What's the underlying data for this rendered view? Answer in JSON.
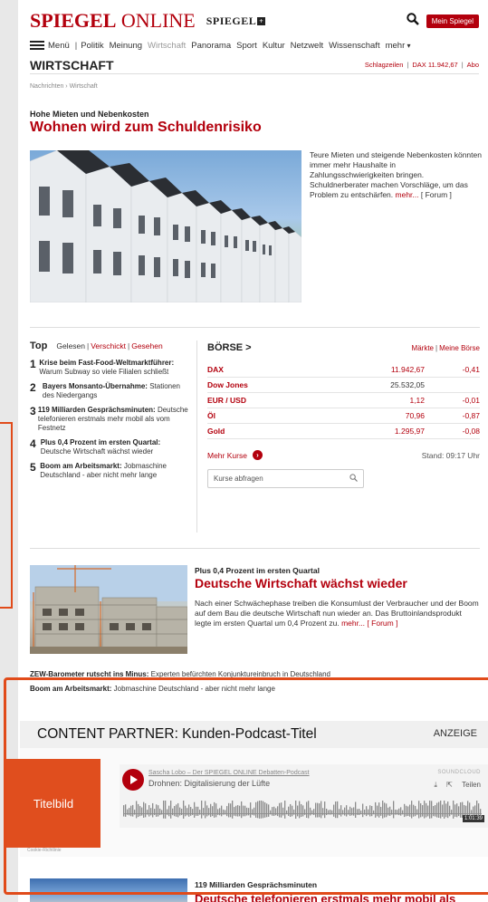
{
  "header": {
    "logo_main": "SPIEGEL",
    "logo_suffix": " ONLINE",
    "logo_secondary": "SPIEGEL",
    "logo_secondary_plus": "+",
    "search_icon": "search-icon",
    "mein_spiegel": "Mein Spiegel"
  },
  "nav": {
    "menu": "Menü",
    "items": [
      "Politik",
      "Meinung",
      "Wirtschaft",
      "Panorama",
      "Sport",
      "Kultur",
      "Netzwelt",
      "Wissenschaft"
    ],
    "more": "mehr"
  },
  "section": {
    "title": "WIRTSCHAFT",
    "link_schlagzeilen": "Schlagzeilen",
    "link_dax": "DAX 11.942,67",
    "link_abo": "Abo"
  },
  "breadcrumb": "Nachrichten › Wirtschaft",
  "lead": {
    "kicker": "Hohe Mieten und Nebenkosten",
    "headline": "Wohnen wird zum Schuldenrisiko",
    "teaser": "Teure Mieten und steigende Nebenkosten könnten immer mehr Haushalte in Zahlungsschwierigkeiten bringen. Schuldnerberater machen Vorschläge, um das Problem zu entschärfen.",
    "more": "mehr...",
    "forum": "[ Forum ]"
  },
  "top": {
    "title": "Top",
    "tabs": [
      "Gelesen",
      "Verschickt",
      "Gesehen"
    ],
    "items": [
      {
        "num": "1",
        "bold": "Krise beim Fast-Food-Weltmarktführer:",
        "text": "Warum Subway so viele Filialen schließt"
      },
      {
        "num": "2",
        "bold": "Bayers Monsanto-Übernahme:",
        "text": "Stationen des Niedergangs"
      },
      {
        "num": "3",
        "bold": "119 Milliarden Gesprächsminuten:",
        "text": "Deutsche telefonieren erstmals mehr mobil als vom Festnetz"
      },
      {
        "num": "4",
        "bold": "Plus 0,4 Prozent im ersten Quartal:",
        "text": "Deutsche Wirtschaft wächst wieder"
      },
      {
        "num": "5",
        "bold": "Boom am Arbeitsmarkt:",
        "text": "Jobmaschine Deutschland - aber nicht mehr lange"
      }
    ]
  },
  "boerse": {
    "title": "BÖRSE >",
    "link_maerkte": "Märkte",
    "link_meine": "Meine Börse",
    "rows": [
      {
        "name": "DAX",
        "value": "11.942,67",
        "change": "-0,41"
      },
      {
        "name": "Dow Jones",
        "value": "25.532,05",
        "change": ""
      },
      {
        "name": "EUR / USD",
        "value": "1,12",
        "change": "-0,01"
      },
      {
        "name": "Öl",
        "value": "70,96",
        "change": "-0,87"
      },
      {
        "name": "Gold",
        "value": "1.295,97",
        "change": "-0,08"
      }
    ],
    "more_kurse": "Mehr Kurse",
    "stand": "Stand: 09:17 Uhr",
    "search_placeholder": "Kurse abfragen"
  },
  "article2": {
    "kicker": "Plus 0,4 Prozent im ersten Quartal",
    "headline": "Deutsche Wirtschaft wächst wieder",
    "teaser": "Nach einer Schwächephase treiben die Konsumlust der Verbraucher und der Boom auf dem Bau die deutsche Wirtschaft nun wieder an. Das Bruttoinlandsprodukt legte im ersten Quartal um 0,4 Prozent zu.",
    "more": "mehr...",
    "forum": "[ Forum ]"
  },
  "shortlines": {
    "l1_bold": "ZEW-Barometer rutscht ins Minus:",
    "l1_text": " Experten befürchten Konjunktureinbruch in Deutschland",
    "l2_bold": "Boom am Arbeitsmarkt:",
    "l2_text": " Jobmaschine Deutschland - aber nicht mehr lange"
  },
  "content_partner": {
    "title": "CONTENT PARTNER: Kunden-Podcast-Titel",
    "anzeige": "ANZEIGE",
    "titelbild": "Titelbild",
    "player_author": "Sascha Lobo – Der SPIEGEL ONLINE Debatten-Podcast",
    "player_title": "Drohnen: Digitalisierung der Lüfte",
    "soundcloud": "SOUNDCLOUD",
    "teilen": "Teilen",
    "time": "1:01:39",
    "cookie": "Cookie-Richtlinie"
  },
  "article3": {
    "kicker": "119 Milliarden Gesprächsminuten",
    "headline": "Deutsche telefonieren erstmals mehr mobil als"
  }
}
